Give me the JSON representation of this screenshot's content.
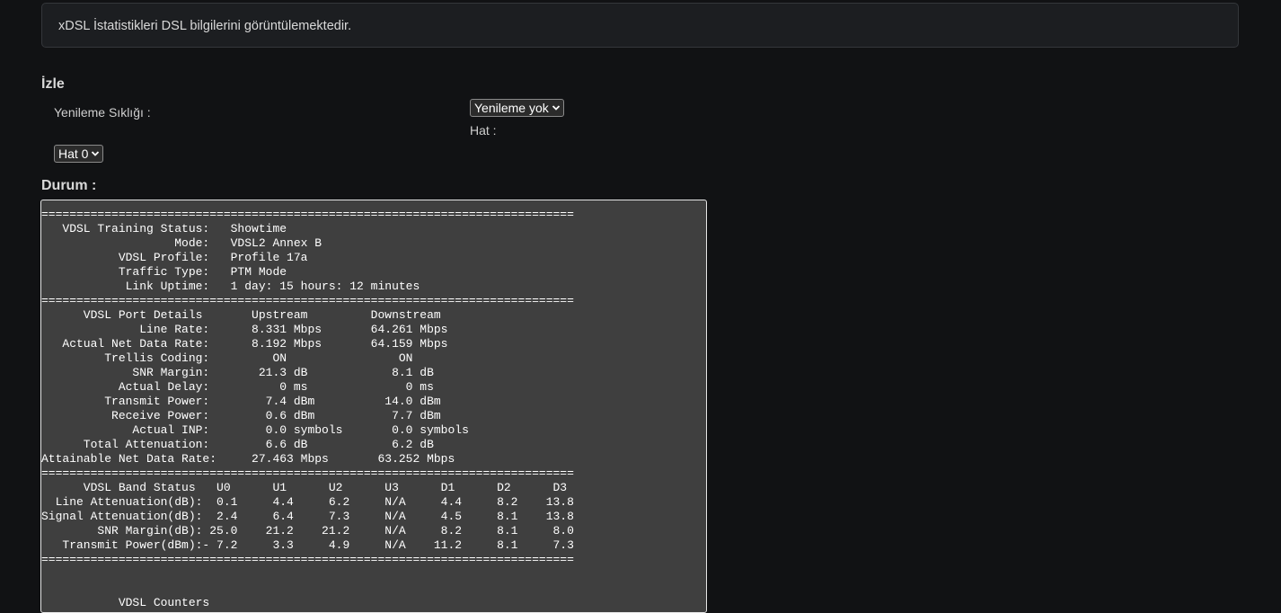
{
  "info": {
    "text": "xDSL İstatistikleri DSL bilgilerini görüntülemektedir."
  },
  "monitor": {
    "title": "İzle",
    "refresh_label": "Yenileme Sıklığı :",
    "refresh_value": "Yenileme yok",
    "line_label": "Hat :",
    "line_value": "Hat 0"
  },
  "status": {
    "title": "Durum :",
    "lines": [
      "============================================================================",
      "   VDSL Training Status:   Showtime",
      "                   Mode:   VDSL2 Annex B",
      "           VDSL Profile:   Profile 17a",
      "           Traffic Type:   PTM Mode",
      "            Link Uptime:   1 day: 15 hours: 12 minutes",
      "============================================================================",
      "      VDSL Port Details       Upstream         Downstream",
      "              Line Rate:      8.331 Mbps       64.261 Mbps",
      "   Actual Net Data Rate:      8.192 Mbps       64.159 Mbps",
      "         Trellis Coding:         ON                ON",
      "             SNR Margin:       21.3 dB            8.1 dB",
      "           Actual Delay:          0 ms              0 ms",
      "         Transmit Power:        7.4 dBm          14.0 dBm",
      "          Receive Power:        0.6 dBm           7.7 dBm",
      "             Actual INP:        0.0 symbols       0.0 symbols",
      "      Total Attenuation:        6.6 dB            6.2 dB",
      "Attainable Net Data Rate:     27.463 Mbps       63.252 Mbps",
      "============================================================================",
      "      VDSL Band Status   U0      U1      U2      U3      D1      D2      D3",
      "  Line Attenuation(dB):  0.1     4.4     6.2     N/A     4.4     8.2    13.8",
      "Signal Attenuation(dB):  2.4     6.4     7.3     N/A     4.5     8.1    13.8",
      "        SNR Margin(dB): 25.0    21.2    21.2     N/A     8.2     8.1     8.0",
      "   Transmit Power(dBm):- 7.2     3.3     4.9     N/A    11.2     8.1     7.3",
      "============================================================================",
      "",
      "",
      "           VDSL Counters"
    ]
  }
}
